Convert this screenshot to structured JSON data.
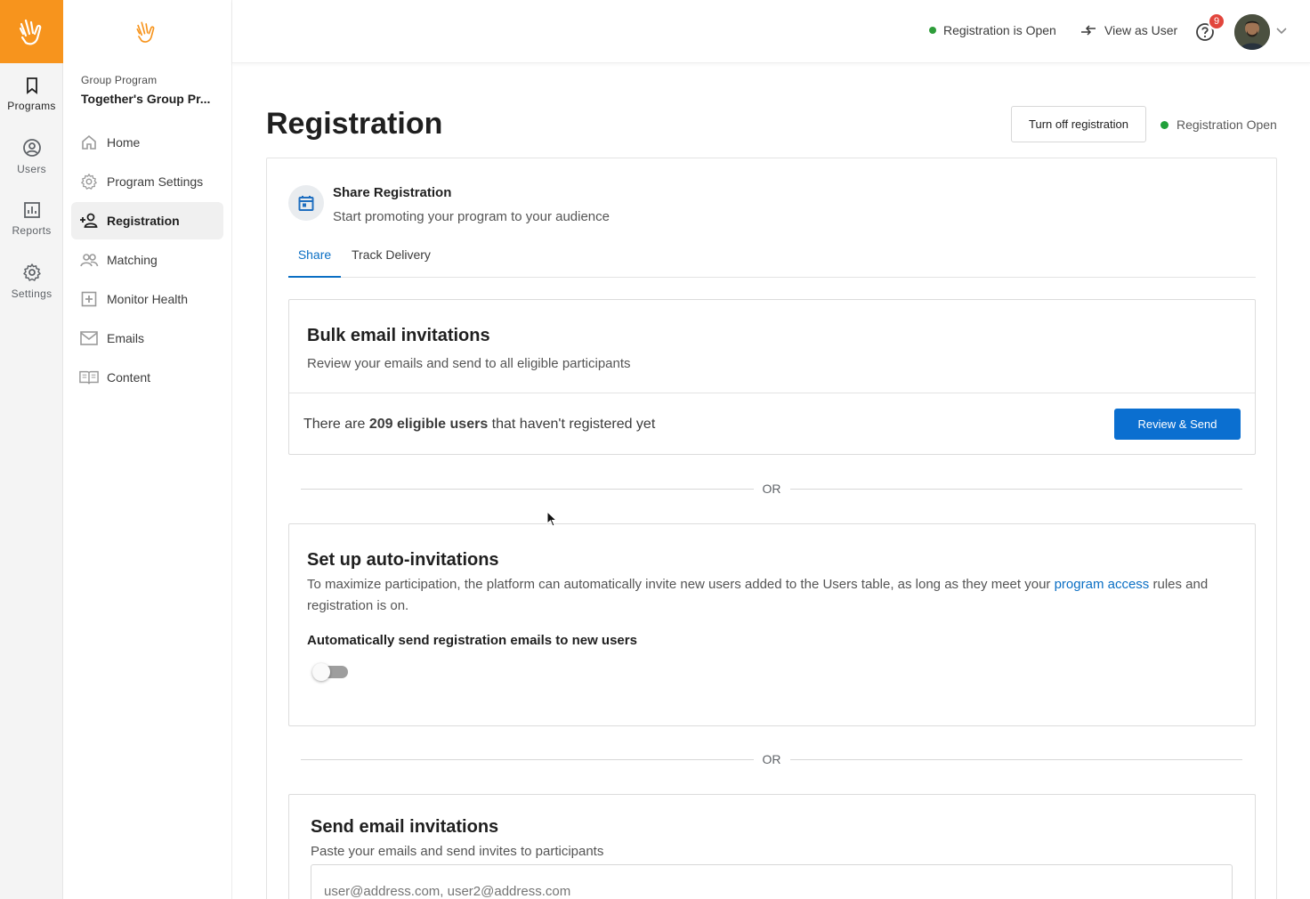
{
  "rail": {
    "items": [
      {
        "label": "Programs",
        "icon": "bookmark-icon"
      },
      {
        "label": "Users",
        "icon": "user-circle-icon"
      },
      {
        "label": "Reports",
        "icon": "bar-chart-icon"
      },
      {
        "label": "Settings",
        "icon": "gear-icon"
      }
    ],
    "brand_color": "#f7941d"
  },
  "sidebar": {
    "program_type": "Group Program",
    "program_name": "Together's Group Pr...",
    "items": [
      {
        "label": "Home",
        "icon": "home-icon"
      },
      {
        "label": "Program Settings",
        "icon": "gear-icon"
      },
      {
        "label": "Registration",
        "icon": "add-user-icon",
        "active": true
      },
      {
        "label": "Matching",
        "icon": "people-icon"
      },
      {
        "label": "Monitor Health",
        "icon": "plus-box-icon"
      },
      {
        "label": "Emails",
        "icon": "mail-icon"
      },
      {
        "label": "Content",
        "icon": "book-icon"
      }
    ]
  },
  "topbar": {
    "status": "Registration is Open",
    "view_as_user": "View as User",
    "notification_count": "9"
  },
  "page": {
    "title": "Registration",
    "turn_off_button": "Turn off registration",
    "status": "Registration Open"
  },
  "share": {
    "title": "Share Registration",
    "subtitle": "Start promoting your program to your audience",
    "tabs": [
      "Share",
      "Track Delivery"
    ]
  },
  "bulk": {
    "title": "Bulk email invitations",
    "description": "Review your emails and send to all eligible participants",
    "count_prefix": "There are ",
    "count_bold": "209 eligible users",
    "count_suffix": " that haven't registered yet",
    "button": "Review & Send"
  },
  "or_text": "OR",
  "auto": {
    "title": "Set up auto-invitations",
    "description_pre": "To maximize participation, the platform can automatically invite new users added to the Users table, as long as they meet your ",
    "description_link": "program access",
    "description_post": " rules and registration is on.",
    "toggle_label": "Automatically send registration emails to new users",
    "toggle_on": false
  },
  "send": {
    "title": "Send email invitations",
    "description": "Paste your emails and send invites to participants",
    "placeholder": "user@address.com, user2@address.com"
  }
}
